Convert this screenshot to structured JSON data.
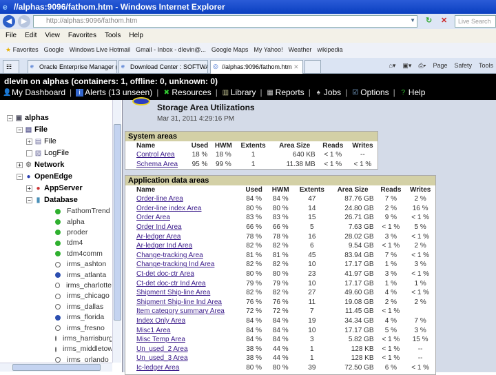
{
  "window": {
    "title": "//alphas:9096/fathom.htm - Windows Internet Explorer"
  },
  "address": {
    "url": "http://alphas:9096/fathom.htm",
    "search_placeholder": "Live Search"
  },
  "menu": [
    "File",
    "Edit",
    "View",
    "Favorites",
    "Tools",
    "Help"
  ],
  "favorites": {
    "label": "Favorites",
    "items": [
      "Google",
      "Windows Live Hotmail",
      "Gmail - Inbox - dlevin@...",
      "Google Maps",
      "My Yahoo!",
      "Weather",
      "wikipedia"
    ]
  },
  "tabs": [
    {
      "label": "Oracle Enterprise Manager (...",
      "active": false
    },
    {
      "label": "Download Center : SOFTWA...",
      "active": false
    },
    {
      "label": "//alphas:9096/fathom.htm",
      "active": true
    }
  ],
  "commands": [
    "Page",
    "Safety",
    "Tools"
  ],
  "app": {
    "status": "dlevin on alphas (containers: 1, offline: 0, unknown: 0)",
    "nav": [
      {
        "label": "My Dashboard",
        "icon": "user-icon"
      },
      {
        "label": "Alerts (13 unseen)",
        "icon": "alert-icon"
      },
      {
        "label": "Resources",
        "icon": "resources-icon"
      },
      {
        "label": "Library",
        "icon": "library-icon"
      },
      {
        "label": "Reports",
        "icon": "reports-icon"
      },
      {
        "label": "Jobs",
        "icon": "jobs-icon"
      },
      {
        "label": "Options",
        "icon": "options-icon"
      },
      {
        "label": "Help",
        "icon": "help-icon"
      }
    ]
  },
  "tree": [
    {
      "label": "alphas",
      "level": 0,
      "toggle": "-",
      "bold": true,
      "icon": "server-icon"
    },
    {
      "label": "File",
      "level": 1,
      "toggle": "-",
      "bold": true,
      "icon": "file-icon"
    },
    {
      "label": "File",
      "level": 2,
      "toggle": "+",
      "bold": false,
      "icon": "file-icon"
    },
    {
      "label": "LogFile",
      "level": 2,
      "toggle": "",
      "bold": false,
      "icon": "logfile-icon"
    },
    {
      "label": "Network",
      "level": 1,
      "toggle": "+",
      "bold": true,
      "icon": "network-icon"
    },
    {
      "label": "OpenEdge",
      "level": 1,
      "toggle": "-",
      "bold": true,
      "icon": "openedge-icon"
    },
    {
      "label": "AppServer",
      "level": 2,
      "toggle": "+",
      "bold": true,
      "icon": "appserver-icon"
    },
    {
      "label": "Database",
      "level": 2,
      "toggle": "-",
      "bold": true,
      "icon": "database-icon"
    }
  ],
  "databases": [
    {
      "label": "FathomTrend",
      "status": "up"
    },
    {
      "label": "alpha",
      "status": "up"
    },
    {
      "label": "proder",
      "status": "up"
    },
    {
      "label": "tdm4",
      "status": "up"
    },
    {
      "label": "tdm4comm",
      "status": "up"
    },
    {
      "label": "irms_ashton",
      "status": "off"
    },
    {
      "label": "irms_atlanta",
      "status": "connected"
    },
    {
      "label": "irms_charlotte",
      "status": "off"
    },
    {
      "label": "irms_chicago",
      "status": "off"
    },
    {
      "label": "irms_dallas",
      "status": "off"
    },
    {
      "label": "irms_florida",
      "status": "connected"
    },
    {
      "label": "irms_fresno",
      "status": "off"
    },
    {
      "label": "irms_harrisburg",
      "status": "off"
    },
    {
      "label": "irms_middletown",
      "status": "off"
    },
    {
      "label": "irms_orlando",
      "status": "off"
    }
  ],
  "colors": {
    "up": "#2fb02f",
    "connected": "#2c4fb0",
    "off": "#ffffff",
    "header": "#d3d0a6",
    "link": "#3a1a8a"
  },
  "page": {
    "title": "Storage Area Utilizations",
    "date": "Mar 31, 2011 4:29:16 PM"
  },
  "system_areas": {
    "title": "System areas",
    "columns": [
      "Name",
      "Used",
      "HWM",
      "Extents",
      "Area Size",
      "Reads",
      "Writes"
    ],
    "rows": [
      [
        "Control Area",
        "18 %",
        "18 %",
        "1",
        "640 KB",
        "< 1 %",
        "--"
      ],
      [
        "Schema Area",
        "95 %",
        "99 %",
        "1",
        "11.38 MB",
        "< 1 %",
        "< 1 %"
      ]
    ]
  },
  "app_areas": {
    "title": "Application data areas",
    "columns": [
      "Name",
      "Used",
      "HWM",
      "Extents",
      "Area Size",
      "Reads",
      "Writes"
    ],
    "rows": [
      [
        "Order-line Area",
        "84 %",
        "84 %",
        "47",
        "87.76 GB",
        "7 %",
        "2 %"
      ],
      [
        "Order-line index Area",
        "80 %",
        "80 %",
        "14",
        "24.80 GB",
        "2 %",
        "16 %"
      ],
      [
        "Order Area",
        "83 %",
        "83 %",
        "15",
        "26.71 GB",
        "9 %",
        "< 1 %"
      ],
      [
        "Order Ind Area",
        "66 %",
        "66 %",
        "5",
        "7.63 GB",
        "< 1 %",
        "5 %"
      ],
      [
        "Ar-ledger Area",
        "78 %",
        "78 %",
        "16",
        "28.02 GB",
        "3 %",
        "< 1 %"
      ],
      [
        "Ar-ledger Ind Area",
        "82 %",
        "82 %",
        "6",
        "9.54 GB",
        "< 1 %",
        "2 %"
      ],
      [
        "Change-tracking Area",
        "81 %",
        "81 %",
        "45",
        "83.94 GB",
        "7 %",
        "< 1 %"
      ],
      [
        "Change-tracking Ind Area",
        "82 %",
        "82 %",
        "10",
        "17.17 GB",
        "1 %",
        "3 %"
      ],
      [
        "Ct-det doc-ctr Area",
        "80 %",
        "80 %",
        "23",
        "41.97 GB",
        "3 %",
        "< 1 %"
      ],
      [
        "Ct-det doc-ctr Ind Area",
        "79 %",
        "79 %",
        "10",
        "17.17 GB",
        "1 %",
        "1 %"
      ],
      [
        "Shipment Ship-line Area",
        "82 %",
        "82 %",
        "27",
        "49.60 GB",
        "4 %",
        "< 1 %"
      ],
      [
        "Shipment Ship-line Ind Area",
        "76 %",
        "76 %",
        "11",
        "19.08 GB",
        "2 %",
        "2 %"
      ],
      [
        "Item category summary Area",
        "72 %",
        "72 %",
        "7",
        "11.45 GB",
        "< 1 %",
        ""
      ],
      [
        "Index Only Area",
        "84 %",
        "84 %",
        "19",
        "34.34 GB",
        "4 %",
        "7 %"
      ],
      [
        "Misc1 Area",
        "84 %",
        "84 %",
        "10",
        "17.17 GB",
        "5 %",
        "3 %"
      ],
      [
        "Misc Temp Area",
        "84 %",
        "84 %",
        "3",
        "5.82 GB",
        "< 1 %",
        "15 %"
      ],
      [
        "Un_used_2 Area",
        "38 %",
        "44 %",
        "1",
        "128 KB",
        "< 1 %",
        "--"
      ],
      [
        "Un_used_3 Area",
        "38 %",
        "44 %",
        "1",
        "128 KB",
        "< 1 %",
        "--"
      ],
      [
        "Ic-ledger Area",
        "80 %",
        "80 %",
        "39",
        "72.50 GB",
        "6 %",
        "< 1 %"
      ]
    ]
  }
}
